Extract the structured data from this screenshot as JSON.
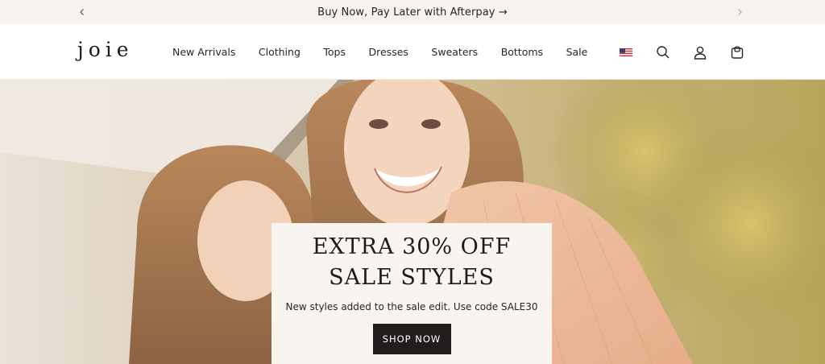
{
  "announcement": {
    "prev_icon": "chevron-left-icon",
    "next_icon": "chevron-right-icon",
    "message": "Buy Now, Pay Later with Afterpay →"
  },
  "header": {
    "logo": "joie",
    "nav": [
      {
        "label": "New Arrivals"
      },
      {
        "label": "Clothing"
      },
      {
        "label": "Tops"
      },
      {
        "label": "Dresses"
      },
      {
        "label": "Sweaters"
      },
      {
        "label": "Bottoms"
      },
      {
        "label": "Sale"
      }
    ],
    "utilities": [
      "us-flag-icon",
      "search-icon",
      "account-icon",
      "cart-icon"
    ]
  },
  "hero": {
    "headline": "EXTRA 30% OFF SALE STYLES",
    "subtext": "New styles added to the sale edit. Use code SALE30",
    "cta": "SHOP NOW"
  },
  "colors": {
    "announcement_bg": "#f6f2ed",
    "promo_bg": "#f8f4ef",
    "cta_bg": "#211d1c",
    "text": "#1f1b19"
  }
}
